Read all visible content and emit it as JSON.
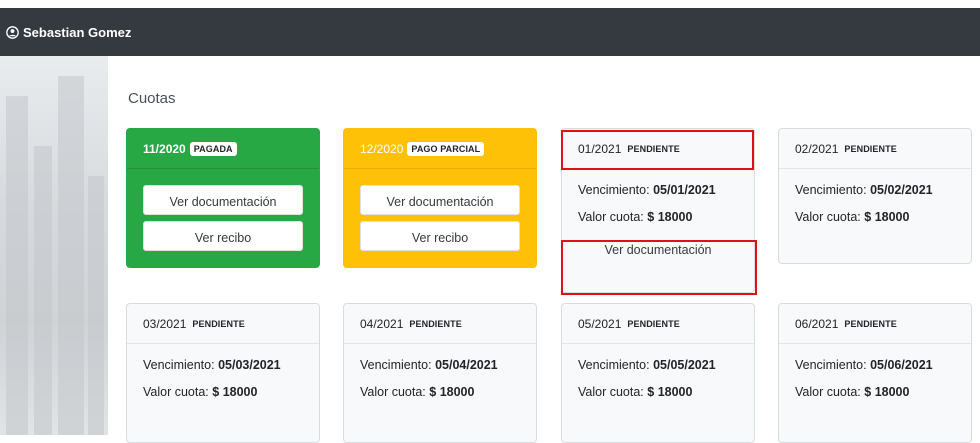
{
  "header": {
    "user_name": "Sebastian Gomez",
    "user_icon": "user-circle-icon",
    "bar_color": "#343a40"
  },
  "section": {
    "title": "Cuotas"
  },
  "labels": {
    "vencimiento": "Vencimiento:",
    "valor_cuota": "Valor cuota:",
    "ver_documentacion": "Ver documentación",
    "ver_recibo": "Ver recibo"
  },
  "colors": {
    "pagada": "#28a745",
    "pago_parcial": "#ffc107",
    "pendiente": "#f8f9fa",
    "highlight": "#e0101a"
  },
  "cards": [
    {
      "period": "11/2020",
      "status": "PAGADA"
    },
    {
      "period": "12/2020",
      "status": "PAGO PARCIAL"
    },
    {
      "period": "01/2021",
      "status": "PENDIENTE",
      "vencimiento": "05/01/2021",
      "valor": "$ 18000"
    },
    {
      "period": "02/2021",
      "status": "PENDIENTE",
      "vencimiento": "05/02/2021",
      "valor": "$ 18000"
    },
    {
      "period": "03/2021",
      "status": "PENDIENTE",
      "vencimiento": "05/03/2021",
      "valor": "$ 18000"
    },
    {
      "period": "04/2021",
      "status": "PENDIENTE",
      "vencimiento": "05/04/2021",
      "valor": "$ 18000"
    },
    {
      "period": "05/2021",
      "status": "PENDIENTE",
      "vencimiento": "05/05/2021",
      "valor": "$ 18000"
    },
    {
      "period": "06/2021",
      "status": "PENDIENTE",
      "vencimiento": "05/06/2021",
      "valor": "$ 18000"
    }
  ]
}
